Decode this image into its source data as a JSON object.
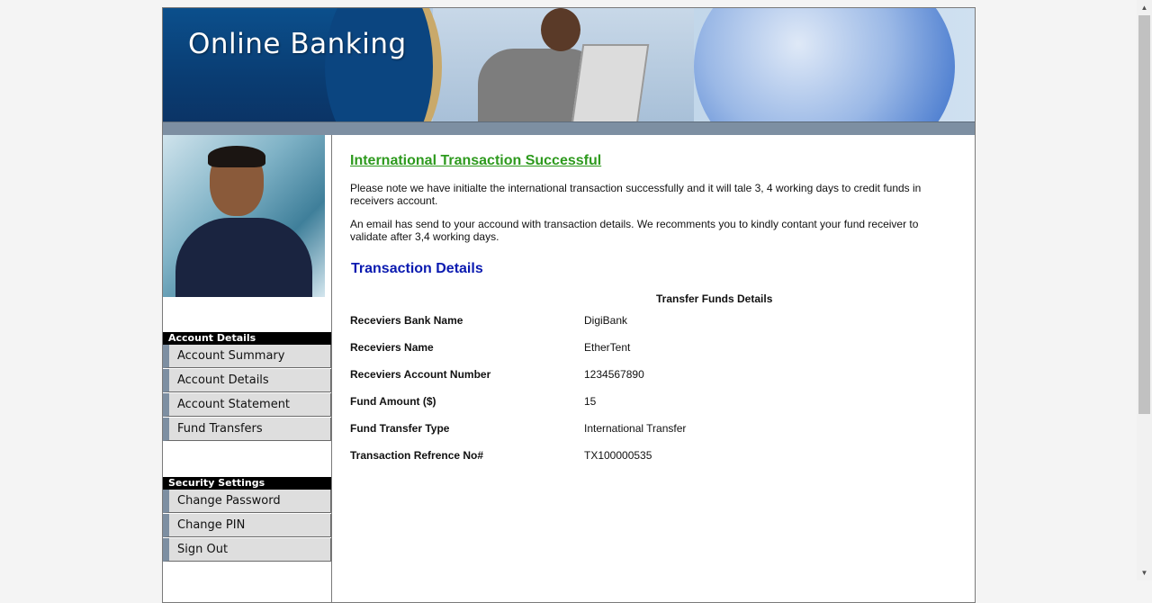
{
  "banner": {
    "title": "Online Banking"
  },
  "sidebar": {
    "account_section": {
      "header": "Account Details",
      "items": [
        {
          "label": "Account Summary"
        },
        {
          "label": "Account Details"
        },
        {
          "label": "Account Statement"
        },
        {
          "label": "Fund Transfers"
        }
      ]
    },
    "security_section": {
      "header": "Security Settings",
      "items": [
        {
          "label": "Change Password"
        },
        {
          "label": "Change PIN"
        },
        {
          "label": "Sign Out"
        }
      ]
    }
  },
  "main": {
    "success_title": "International Transaction Successful",
    "paragraph1": "Please note we have initialte the international transaction successfully and it will tale 3, 4 working days to credit funds in receivers account.",
    "paragraph2": "An email has send to your accound with transaction details. We recomments you to kindly contant your fund receiver to validate after 3,4 working days.",
    "details_title": "Transaction Details",
    "table_caption": "Transfer Funds Details",
    "rows": [
      {
        "label": "Receviers Bank Name",
        "value": "DigiBank"
      },
      {
        "label": "Receviers Name",
        "value": "EtherTent"
      },
      {
        "label": "Receviers Account Number",
        "value": "1234567890"
      },
      {
        "label": "Fund Amount ($)",
        "value": "15"
      },
      {
        "label": "Fund Transfer Type",
        "value": "International Transfer"
      },
      {
        "label": "Transaction Refrence No#",
        "value": "TX100000535"
      }
    ]
  },
  "colors": {
    "success": "#2e9a1e",
    "heading_blue": "#0a1ab0",
    "menu_header_bg": "#000000",
    "menu_item_bg": "#dedede",
    "menu_accent": "#7d8fa2"
  },
  "icons": {
    "scroll_up": "triangle-up-icon",
    "scroll_down": "triangle-down-icon"
  }
}
